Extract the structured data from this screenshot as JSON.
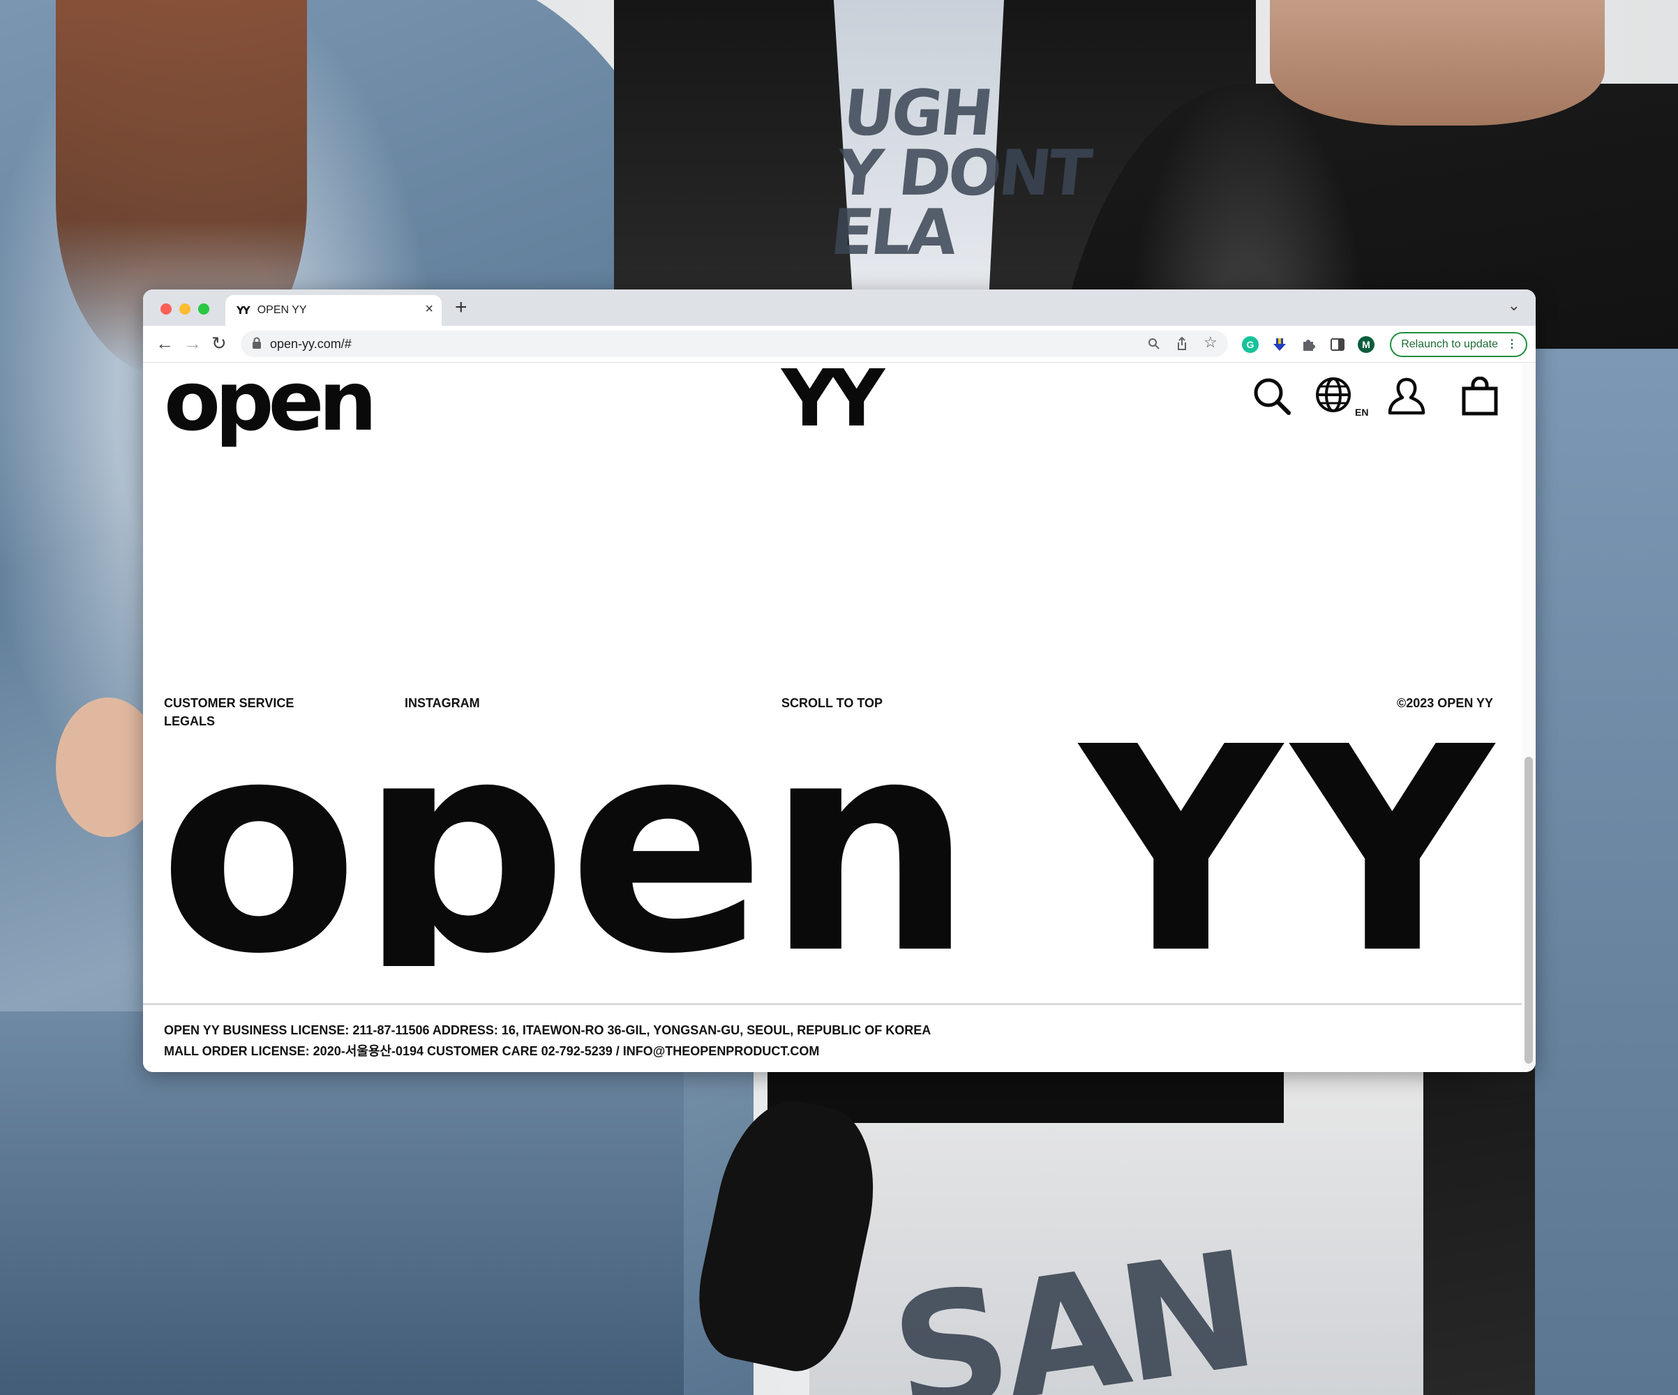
{
  "browser": {
    "tab_favicon": "YY",
    "tab_title": "OPEN YY",
    "tab_close": "×",
    "new_tab": "+",
    "tab_menu": "⌄",
    "url": "open-yy.com/#",
    "relaunch_label": "Relaunch to update",
    "profile_initial": "M",
    "grammarly_initial": "G"
  },
  "header": {
    "logo_left": "open",
    "logo_center": "YY",
    "language": "EN"
  },
  "footer": {
    "links": [
      "CUSTOMER SERVICE",
      "LEGALS",
      "INSTAGRAM",
      "SCROLL TO TOP"
    ],
    "copyright": "©2023 OPEN YY",
    "brand_big": "open YY",
    "legal_line1": "OPEN YY BUSINESS LICENSE: 211-87-11506 ADDRESS: 16, ITAEWON-RO 36-GIL, YONGSAN-GU, SEOUL, REPUBLIC OF KOREA",
    "legal_line2": "MALL ORDER LICENSE: 2020-서울용산-0194 CUSTOMER CARE 02-792-5239 / INFO@THEOPENPRODUCT.COM"
  },
  "background_print": {
    "shirt_text": "UGH\nY DONT\nELA",
    "pants_text": "SAN"
  },
  "colors": {
    "relaunch_green": "#1e8e3e",
    "traffic_red": "#ff5f57",
    "traffic_yellow": "#febc2e",
    "traffic_green": "#28c840"
  }
}
